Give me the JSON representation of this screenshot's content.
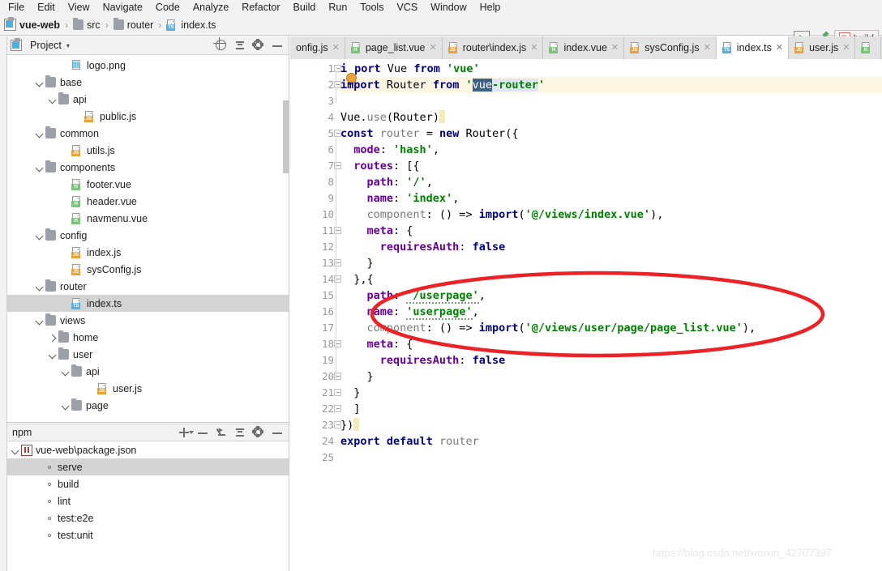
{
  "menubar": {
    "items": [
      "File",
      "Edit",
      "View",
      "Navigate",
      "Code",
      "Analyze",
      "Refactor",
      "Build",
      "Run",
      "Tools",
      "VCS",
      "Window",
      "Help"
    ]
  },
  "breadcrumb": {
    "items": [
      {
        "label": "vue-web",
        "icon": "module-icon",
        "type": "module"
      },
      {
        "label": "src",
        "icon": "folder-icon",
        "type": "folder"
      },
      {
        "label": "router",
        "icon": "folder-icon",
        "type": "folder"
      },
      {
        "label": "index.ts",
        "icon": "typescript-file-icon",
        "type": "ts"
      }
    ],
    "separator": "›"
  },
  "toolbar": {
    "run_icon": "run-icon",
    "build_icon": "hammer-build-icon",
    "run_config_label": "build"
  },
  "project_panel": {
    "title": "Project",
    "caret": "▾",
    "icons": [
      "locate-target-icon",
      "collapse-all-icon",
      "settings-gear-icon",
      "hide-panel-icon"
    ],
    "tree": [
      {
        "label": "logo.png",
        "indent": 4,
        "twist": "none",
        "icon": "image-file-icon",
        "badge": "",
        "selected": false
      },
      {
        "label": "base",
        "indent": 2,
        "twist": "open",
        "icon": "folder-icon",
        "badge": "",
        "selected": false
      },
      {
        "label": "api",
        "indent": 3,
        "twist": "open",
        "icon": "folder-icon",
        "badge": "",
        "selected": false
      },
      {
        "label": "public.js",
        "indent": 5,
        "twist": "none",
        "icon": "javascript-file-icon",
        "badge": "JS",
        "selected": false
      },
      {
        "label": "common",
        "indent": 2,
        "twist": "open",
        "icon": "folder-icon",
        "badge": "",
        "selected": false
      },
      {
        "label": "utils.js",
        "indent": 4,
        "twist": "none",
        "icon": "javascript-file-icon",
        "badge": "JS",
        "selected": false
      },
      {
        "label": "components",
        "indent": 2,
        "twist": "open",
        "icon": "folder-icon",
        "badge": "",
        "selected": false
      },
      {
        "label": "footer.vue",
        "indent": 4,
        "twist": "none",
        "icon": "vue-file-icon",
        "badge": "H",
        "selected": false
      },
      {
        "label": "header.vue",
        "indent": 4,
        "twist": "none",
        "icon": "vue-file-icon",
        "badge": "H",
        "selected": false
      },
      {
        "label": "navmenu.vue",
        "indent": 4,
        "twist": "none",
        "icon": "vue-file-icon",
        "badge": "H",
        "selected": false
      },
      {
        "label": "config",
        "indent": 2,
        "twist": "open",
        "icon": "folder-icon",
        "badge": "",
        "selected": false
      },
      {
        "label": "index.js",
        "indent": 4,
        "twist": "none",
        "icon": "javascript-file-icon",
        "badge": "JS",
        "selected": false
      },
      {
        "label": "sysConfig.js",
        "indent": 4,
        "twist": "none",
        "icon": "javascript-file-icon",
        "badge": "JS",
        "selected": false
      },
      {
        "label": "router",
        "indent": 2,
        "twist": "open",
        "icon": "folder-icon",
        "badge": "",
        "selected": false
      },
      {
        "label": "index.ts",
        "indent": 4,
        "twist": "none",
        "icon": "typescript-file-icon",
        "badge": "TS",
        "selected": true
      },
      {
        "label": "views",
        "indent": 2,
        "twist": "open",
        "icon": "folder-icon",
        "badge": "",
        "selected": false
      },
      {
        "label": "home",
        "indent": 3,
        "twist": "closed",
        "icon": "folder-icon",
        "badge": "",
        "selected": false
      },
      {
        "label": "user",
        "indent": 3,
        "twist": "open",
        "icon": "folder-icon",
        "badge": "",
        "selected": false
      },
      {
        "label": "api",
        "indent": 4,
        "twist": "open",
        "icon": "folder-icon",
        "badge": "",
        "selected": false
      },
      {
        "label": "user.js",
        "indent": 6,
        "twist": "none",
        "icon": "javascript-file-icon",
        "badge": "JS",
        "selected": false
      },
      {
        "label": "page",
        "indent": 4,
        "twist": "open",
        "icon": "folder-icon",
        "badge": "",
        "selected": false
      }
    ]
  },
  "npm_panel": {
    "title": "npm",
    "icons": [
      "add-icon",
      "remove-icon",
      "jump-to-source-icon",
      "collapse-all-icon",
      "settings-gear-icon",
      "hide-panel-icon"
    ],
    "root": "vue-web\\package.json",
    "scripts": [
      {
        "label": "serve",
        "selected": true
      },
      {
        "label": "build",
        "selected": false
      },
      {
        "label": "lint",
        "selected": false
      },
      {
        "label": "test:e2e",
        "selected": false
      },
      {
        "label": "test:unit",
        "selected": false
      }
    ]
  },
  "editor_tabs": {
    "tabs": [
      {
        "label": "onfig.js",
        "badge": "",
        "active": false,
        "clipped_left": true
      },
      {
        "label": "page_list.vue",
        "badge": "H",
        "active": false
      },
      {
        "label": "router\\index.js",
        "badge": "JS",
        "active": false
      },
      {
        "label": "index.vue",
        "badge": "H",
        "active": false
      },
      {
        "label": "sysConfig.js",
        "badge": "JS",
        "active": false
      },
      {
        "label": "index.ts",
        "badge": "TS",
        "active": true
      },
      {
        "label": "user.js",
        "badge": "JS",
        "active": false
      },
      {
        "label": "",
        "badge": "H",
        "active": false,
        "clipped_right": true
      }
    ],
    "close_glyph": "✕"
  },
  "editor": {
    "filename": "index.ts",
    "first_line": 1,
    "last_line": 25,
    "highlighted_line": 2,
    "selection_text": "vue",
    "line_numbers": [
      "1",
      "2",
      "3",
      "4",
      "5",
      "6",
      "7",
      "8",
      "9",
      "10",
      "11",
      "12",
      "13",
      "14",
      "15",
      "16",
      "17",
      "18",
      "19",
      "20",
      "21",
      "22",
      "23",
      "24",
      "25"
    ],
    "code_lines": [
      "import Vue from 'vue'",
      "import Router from 'vue-router'",
      "",
      "Vue.use(Router)",
      "const router = new Router({",
      "  mode: 'hash',",
      "  routes: [{",
      "    path: '/',",
      "    name: 'index',",
      "    component: () => import('@/views/index.vue'),",
      "    meta: {",
      "      requiresAuth: false",
      "    }",
      "  },{",
      "    path: '/userpage',",
      "    name: 'userpage',",
      "    component: () => import('@/views/user/page/page_list.vue'),",
      "    meta: {",
      "      requiresAuth: false",
      "    }",
      "  }",
      "  ]",
      "})",
      "export default router",
      ""
    ]
  },
  "annotation": {
    "type": "red-ellipse-highlight",
    "color": "#ec2227",
    "covers_lines": [
      15,
      16,
      17,
      18,
      19
    ]
  },
  "watermark": {
    "text": "https://blog.csdn.net/weixin_42707397"
  },
  "colors": {
    "keyword": "#000080",
    "string": "#008000",
    "property": "#660099",
    "comment_gray": "#8a8a8a",
    "selection": "#3d6185",
    "current_line": "#fdf6e3",
    "annotation_red": "#ec2227",
    "tree_selected": "#d4d4d4"
  }
}
